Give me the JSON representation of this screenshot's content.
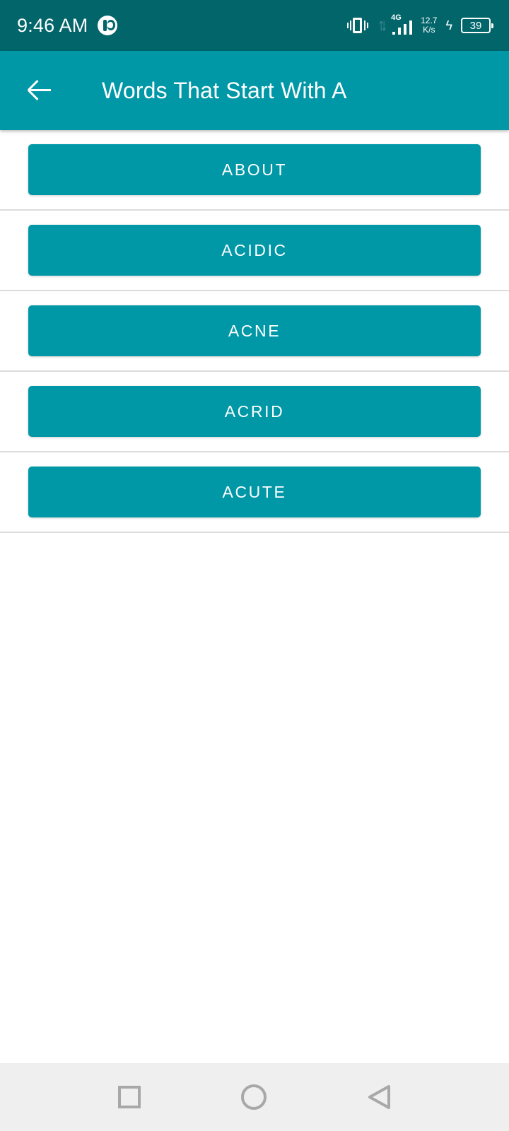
{
  "status_bar": {
    "time": "9:46 AM",
    "network_type": "4G",
    "net_speed_value": "12.7",
    "net_speed_unit": "K/s",
    "battery_level": "39",
    "icons": [
      "notification-icon",
      "vibrate-icon",
      "data-transfer-icon",
      "signal-icon",
      "charging-icon",
      "battery-icon"
    ]
  },
  "app_bar": {
    "title": "Words That Start With A",
    "back_icon": "arrow-left-icon"
  },
  "words": [
    {
      "label": "ABOUT"
    },
    {
      "label": "ACIDIC"
    },
    {
      "label": "ACNE"
    },
    {
      "label": "ACRID"
    },
    {
      "label": "ACUTE"
    }
  ],
  "nav_bar": {
    "icons": [
      "recents-square-icon",
      "home-circle-icon",
      "back-triangle-icon"
    ]
  },
  "colors": {
    "status_bar": "#01656a",
    "app_bar": "#0097a7",
    "button": "#0097a7",
    "divider": "#dcdcdc",
    "nav_bar": "#efefef"
  }
}
